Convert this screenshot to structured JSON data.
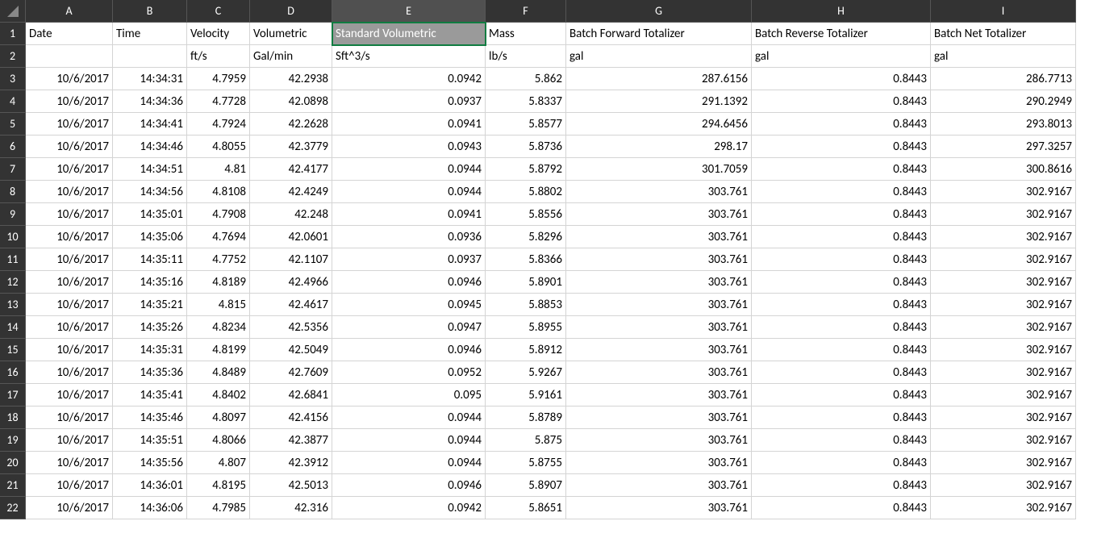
{
  "columns": [
    "A",
    "B",
    "C",
    "D",
    "E",
    "F",
    "G",
    "H",
    "I"
  ],
  "selected_column_index": 4,
  "selected_cell": {
    "row": 1,
    "col": 4
  },
  "header_row_1": [
    "Date",
    "Time",
    "Velocity",
    "Volumetric",
    "Standard Volumetric",
    "Mass",
    "Batch Forward Totalizer",
    "Batch Reverse Totalizer",
    "Batch Net Totalizer"
  ],
  "header_row_2": [
    "",
    "",
    "ft/s",
    "Gal/min",
    "Sft^3/s",
    "lb/s",
    "gal",
    "gal",
    "gal"
  ],
  "column_align": [
    "right",
    "right",
    "right",
    "right",
    "right",
    "right",
    "right",
    "right",
    "right"
  ],
  "header_align": [
    "left",
    "left",
    "left",
    "left",
    "left",
    "left",
    "left",
    "left",
    "left"
  ],
  "rows": [
    [
      "10/6/2017",
      "14:34:31",
      "4.7959",
      "42.2938",
      "0.0942",
      "5.862",
      "287.6156",
      "0.8443",
      "286.7713"
    ],
    [
      "10/6/2017",
      "14:34:36",
      "4.7728",
      "42.0898",
      "0.0937",
      "5.8337",
      "291.1392",
      "0.8443",
      "290.2949"
    ],
    [
      "10/6/2017",
      "14:34:41",
      "4.7924",
      "42.2628",
      "0.0941",
      "5.8577",
      "294.6456",
      "0.8443",
      "293.8013"
    ],
    [
      "10/6/2017",
      "14:34:46",
      "4.8055",
      "42.3779",
      "0.0943",
      "5.8736",
      "298.17",
      "0.8443",
      "297.3257"
    ],
    [
      "10/6/2017",
      "14:34:51",
      "4.81",
      "42.4177",
      "0.0944",
      "5.8792",
      "301.7059",
      "0.8443",
      "300.8616"
    ],
    [
      "10/6/2017",
      "14:34:56",
      "4.8108",
      "42.4249",
      "0.0944",
      "5.8802",
      "303.761",
      "0.8443",
      "302.9167"
    ],
    [
      "10/6/2017",
      "14:35:01",
      "4.7908",
      "42.248",
      "0.0941",
      "5.8556",
      "303.761",
      "0.8443",
      "302.9167"
    ],
    [
      "10/6/2017",
      "14:35:06",
      "4.7694",
      "42.0601",
      "0.0936",
      "5.8296",
      "303.761",
      "0.8443",
      "302.9167"
    ],
    [
      "10/6/2017",
      "14:35:11",
      "4.7752",
      "42.1107",
      "0.0937",
      "5.8366",
      "303.761",
      "0.8443",
      "302.9167"
    ],
    [
      "10/6/2017",
      "14:35:16",
      "4.8189",
      "42.4966",
      "0.0946",
      "5.8901",
      "303.761",
      "0.8443",
      "302.9167"
    ],
    [
      "10/6/2017",
      "14:35:21",
      "4.815",
      "42.4617",
      "0.0945",
      "5.8853",
      "303.761",
      "0.8443",
      "302.9167"
    ],
    [
      "10/6/2017",
      "14:35:26",
      "4.8234",
      "42.5356",
      "0.0947",
      "5.8955",
      "303.761",
      "0.8443",
      "302.9167"
    ],
    [
      "10/6/2017",
      "14:35:31",
      "4.8199",
      "42.5049",
      "0.0946",
      "5.8912",
      "303.761",
      "0.8443",
      "302.9167"
    ],
    [
      "10/6/2017",
      "14:35:36",
      "4.8489",
      "42.7609",
      "0.0952",
      "5.9267",
      "303.761",
      "0.8443",
      "302.9167"
    ],
    [
      "10/6/2017",
      "14:35:41",
      "4.8402",
      "42.6841",
      "0.095",
      "5.9161",
      "303.761",
      "0.8443",
      "302.9167"
    ],
    [
      "10/6/2017",
      "14:35:46",
      "4.8097",
      "42.4156",
      "0.0944",
      "5.8789",
      "303.761",
      "0.8443",
      "302.9167"
    ],
    [
      "10/6/2017",
      "14:35:51",
      "4.8066",
      "42.3877",
      "0.0944",
      "5.875",
      "303.761",
      "0.8443",
      "302.9167"
    ],
    [
      "10/6/2017",
      "14:35:56",
      "4.807",
      "42.3912",
      "0.0944",
      "5.8755",
      "303.761",
      "0.8443",
      "302.9167"
    ],
    [
      "10/6/2017",
      "14:36:01",
      "4.8195",
      "42.5013",
      "0.0946",
      "5.8907",
      "303.761",
      "0.8443",
      "302.9167"
    ],
    [
      "10/6/2017",
      "14:36:06",
      "4.7985",
      "42.316",
      "0.0942",
      "5.8651",
      "303.761",
      "0.8443",
      "302.9167"
    ]
  ]
}
